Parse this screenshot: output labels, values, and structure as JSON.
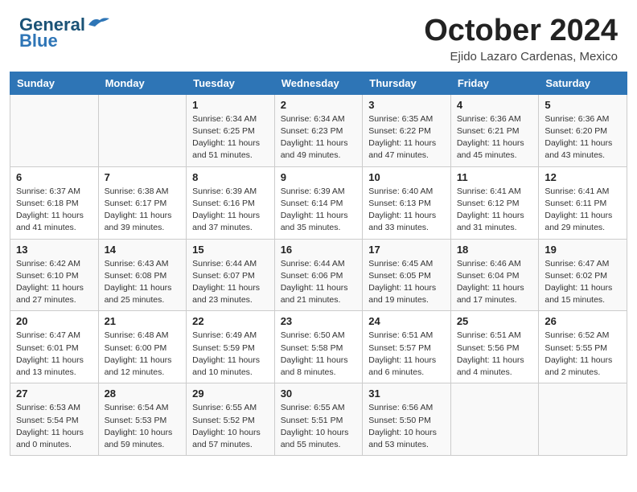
{
  "header": {
    "logo_general": "General",
    "logo_blue": "Blue",
    "month": "October 2024",
    "location": "Ejido Lazaro Cardenas, Mexico"
  },
  "weekdays": [
    "Sunday",
    "Monday",
    "Tuesday",
    "Wednesday",
    "Thursday",
    "Friday",
    "Saturday"
  ],
  "weeks": [
    [
      {
        "day": "",
        "detail": ""
      },
      {
        "day": "",
        "detail": ""
      },
      {
        "day": "1",
        "detail": "Sunrise: 6:34 AM\nSunset: 6:25 PM\nDaylight: 11 hours\nand 51 minutes."
      },
      {
        "day": "2",
        "detail": "Sunrise: 6:34 AM\nSunset: 6:23 PM\nDaylight: 11 hours\nand 49 minutes."
      },
      {
        "day": "3",
        "detail": "Sunrise: 6:35 AM\nSunset: 6:22 PM\nDaylight: 11 hours\nand 47 minutes."
      },
      {
        "day": "4",
        "detail": "Sunrise: 6:36 AM\nSunset: 6:21 PM\nDaylight: 11 hours\nand 45 minutes."
      },
      {
        "day": "5",
        "detail": "Sunrise: 6:36 AM\nSunset: 6:20 PM\nDaylight: 11 hours\nand 43 minutes."
      }
    ],
    [
      {
        "day": "6",
        "detail": "Sunrise: 6:37 AM\nSunset: 6:18 PM\nDaylight: 11 hours\nand 41 minutes."
      },
      {
        "day": "7",
        "detail": "Sunrise: 6:38 AM\nSunset: 6:17 PM\nDaylight: 11 hours\nand 39 minutes."
      },
      {
        "day": "8",
        "detail": "Sunrise: 6:39 AM\nSunset: 6:16 PM\nDaylight: 11 hours\nand 37 minutes."
      },
      {
        "day": "9",
        "detail": "Sunrise: 6:39 AM\nSunset: 6:14 PM\nDaylight: 11 hours\nand 35 minutes."
      },
      {
        "day": "10",
        "detail": "Sunrise: 6:40 AM\nSunset: 6:13 PM\nDaylight: 11 hours\nand 33 minutes."
      },
      {
        "day": "11",
        "detail": "Sunrise: 6:41 AM\nSunset: 6:12 PM\nDaylight: 11 hours\nand 31 minutes."
      },
      {
        "day": "12",
        "detail": "Sunrise: 6:41 AM\nSunset: 6:11 PM\nDaylight: 11 hours\nand 29 minutes."
      }
    ],
    [
      {
        "day": "13",
        "detail": "Sunrise: 6:42 AM\nSunset: 6:10 PM\nDaylight: 11 hours\nand 27 minutes."
      },
      {
        "day": "14",
        "detail": "Sunrise: 6:43 AM\nSunset: 6:08 PM\nDaylight: 11 hours\nand 25 minutes."
      },
      {
        "day": "15",
        "detail": "Sunrise: 6:44 AM\nSunset: 6:07 PM\nDaylight: 11 hours\nand 23 minutes."
      },
      {
        "day": "16",
        "detail": "Sunrise: 6:44 AM\nSunset: 6:06 PM\nDaylight: 11 hours\nand 21 minutes."
      },
      {
        "day": "17",
        "detail": "Sunrise: 6:45 AM\nSunset: 6:05 PM\nDaylight: 11 hours\nand 19 minutes."
      },
      {
        "day": "18",
        "detail": "Sunrise: 6:46 AM\nSunset: 6:04 PM\nDaylight: 11 hours\nand 17 minutes."
      },
      {
        "day": "19",
        "detail": "Sunrise: 6:47 AM\nSunset: 6:02 PM\nDaylight: 11 hours\nand 15 minutes."
      }
    ],
    [
      {
        "day": "20",
        "detail": "Sunrise: 6:47 AM\nSunset: 6:01 PM\nDaylight: 11 hours\nand 13 minutes."
      },
      {
        "day": "21",
        "detail": "Sunrise: 6:48 AM\nSunset: 6:00 PM\nDaylight: 11 hours\nand 12 minutes."
      },
      {
        "day": "22",
        "detail": "Sunrise: 6:49 AM\nSunset: 5:59 PM\nDaylight: 11 hours\nand 10 minutes."
      },
      {
        "day": "23",
        "detail": "Sunrise: 6:50 AM\nSunset: 5:58 PM\nDaylight: 11 hours\nand 8 minutes."
      },
      {
        "day": "24",
        "detail": "Sunrise: 6:51 AM\nSunset: 5:57 PM\nDaylight: 11 hours\nand 6 minutes."
      },
      {
        "day": "25",
        "detail": "Sunrise: 6:51 AM\nSunset: 5:56 PM\nDaylight: 11 hours\nand 4 minutes."
      },
      {
        "day": "26",
        "detail": "Sunrise: 6:52 AM\nSunset: 5:55 PM\nDaylight: 11 hours\nand 2 minutes."
      }
    ],
    [
      {
        "day": "27",
        "detail": "Sunrise: 6:53 AM\nSunset: 5:54 PM\nDaylight: 11 hours\nand 0 minutes."
      },
      {
        "day": "28",
        "detail": "Sunrise: 6:54 AM\nSunset: 5:53 PM\nDaylight: 10 hours\nand 59 minutes."
      },
      {
        "day": "29",
        "detail": "Sunrise: 6:55 AM\nSunset: 5:52 PM\nDaylight: 10 hours\nand 57 minutes."
      },
      {
        "day": "30",
        "detail": "Sunrise: 6:55 AM\nSunset: 5:51 PM\nDaylight: 10 hours\nand 55 minutes."
      },
      {
        "day": "31",
        "detail": "Sunrise: 6:56 AM\nSunset: 5:50 PM\nDaylight: 10 hours\nand 53 minutes."
      },
      {
        "day": "",
        "detail": ""
      },
      {
        "day": "",
        "detail": ""
      }
    ]
  ]
}
